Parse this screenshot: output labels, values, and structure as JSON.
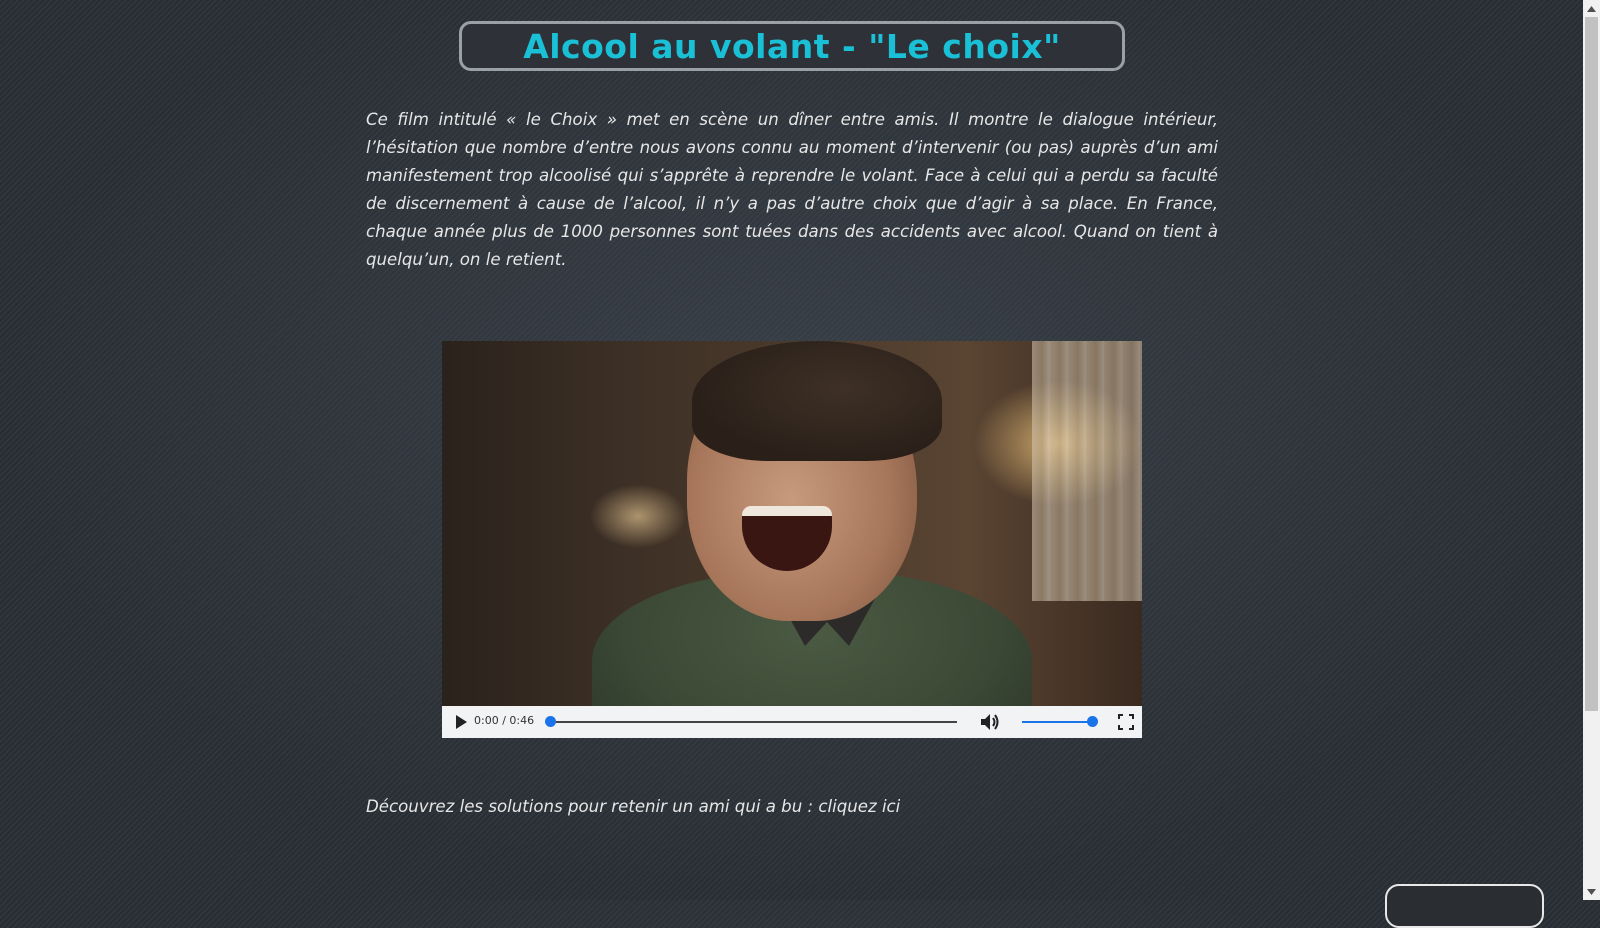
{
  "header": {
    "title": "Alcool au volant - \"Le choix\""
  },
  "intro": {
    "text": "Ce film intitulé « le Choix » met en scène un dîner entre amis. Il montre le dialogue intérieur, l’hésitation que nombre d’entre nous avons connu au moment d’intervenir (ou pas) auprès d’un ami manifestement trop alcoolisé qui s’apprête à reprendre le volant. Face à celui qui a perdu sa faculté de discernement à cause de l’alcool, il n’y a pas d’autre choix que d’agir à sa place. En France, chaque année plus de 1000 personnes sont tuées dans des accidents avec alcool. Quand on tient à quelqu’un, on le retient."
  },
  "video": {
    "time": "0:00 / 0:46",
    "progress_fraction": 0.0,
    "volume_fraction": 1.0,
    "icons": {
      "play": "play-icon",
      "volume": "volume-icon",
      "fullscreen": "fullscreen-icon"
    },
    "accent": "#1a73e8"
  },
  "outro": {
    "text": "Découvrez les solutions pour retenir un ami qui a bu : ",
    "link": "cliquez ici"
  },
  "colors": {
    "title": "#19c0d6",
    "text": "#e6e6e6",
    "background": "#2b3036"
  }
}
